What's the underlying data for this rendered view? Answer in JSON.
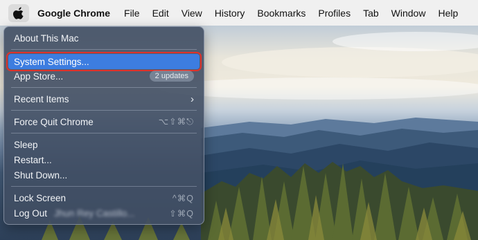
{
  "menubar": {
    "apple_icon": "apple-logo-icon",
    "app_name": "Google Chrome",
    "menus": [
      "File",
      "Edit",
      "View",
      "History",
      "Bookmarks",
      "Profiles",
      "Tab",
      "Window",
      "Help"
    ]
  },
  "apple_menu": {
    "about": "About This Mac",
    "system_settings": "System Settings...",
    "app_store": "App Store...",
    "app_store_badge": "2 updates",
    "recent_items": "Recent Items",
    "recent_items_icon": "chevron-right-icon",
    "force_quit": "Force Quit Chrome",
    "force_quit_shortcut": "⌥⇧⌘⎋",
    "sleep": "Sleep",
    "restart": "Restart...",
    "shut_down": "Shut Down...",
    "lock_screen": "Lock Screen",
    "lock_screen_shortcut": "^⌘Q",
    "log_out": "Log Out",
    "log_out_user": "Jhun Rey Castillo...",
    "log_out_shortcut": "⇧⌘Q"
  },
  "colors": {
    "highlight": "#3d7de0",
    "annotation_box": "#e0322c",
    "menu_bg": "#404e63"
  }
}
